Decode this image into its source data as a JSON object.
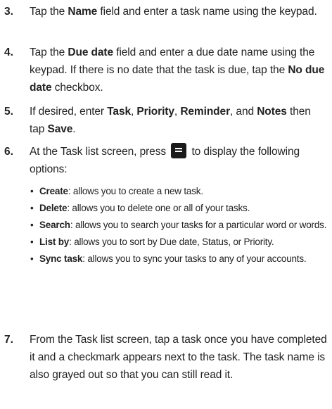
{
  "steps": [
    {
      "num": "3.",
      "segments": [
        {
          "t": "Tap the "
        },
        {
          "t": "Name",
          "b": true
        },
        {
          "t": " field and enter a task name using the keypad."
        }
      ]
    },
    {
      "num": "4.",
      "segments": [
        {
          "t": "Tap the "
        },
        {
          "t": "Due date",
          "b": true
        },
        {
          "t": " field and enter a due date name using the keypad. If there is no date that the task is due, tap the "
        },
        {
          "t": "No due date",
          "b": true
        },
        {
          "t": " checkbox."
        }
      ]
    },
    {
      "num": "5.",
      "segments": [
        {
          "t": "If desired, enter "
        },
        {
          "t": "Task",
          "b": true
        },
        {
          "t": ", "
        },
        {
          "t": "Priority",
          "b": true
        },
        {
          "t": ", "
        },
        {
          "t": "Reminder",
          "b": true
        },
        {
          "t": ", and "
        },
        {
          "t": "Notes",
          "b": true
        },
        {
          "t": " then tap "
        },
        {
          "t": "Save",
          "b": true
        },
        {
          "t": "."
        }
      ]
    },
    {
      "num": "6.",
      "before_icon": "At the Task list screen, press",
      "icon": "menu-key-icon",
      "after_icon": "to display the following options:",
      "bullets": [
        {
          "term": "Create",
          "desc": ": allows you to create a new task."
        },
        {
          "term": "Delete",
          "desc": ": allows you to delete one or all of your tasks."
        },
        {
          "term": "Search",
          "desc": ": allows you to search your tasks for a particular word or words."
        },
        {
          "term": "List by",
          "desc": ": allows you to sort by Due date, Status, or Priority."
        },
        {
          "term": "Sync task",
          "desc": ": allows you to sync your tasks to any of your accounts."
        }
      ]
    },
    {
      "num": "7.",
      "segments": [
        {
          "t": "From the Task list screen, tap a task once you have completed it and a checkmark appears next to the task. The task name is also grayed out so that you can still read it."
        }
      ]
    }
  ],
  "bullet_glyph": "•"
}
